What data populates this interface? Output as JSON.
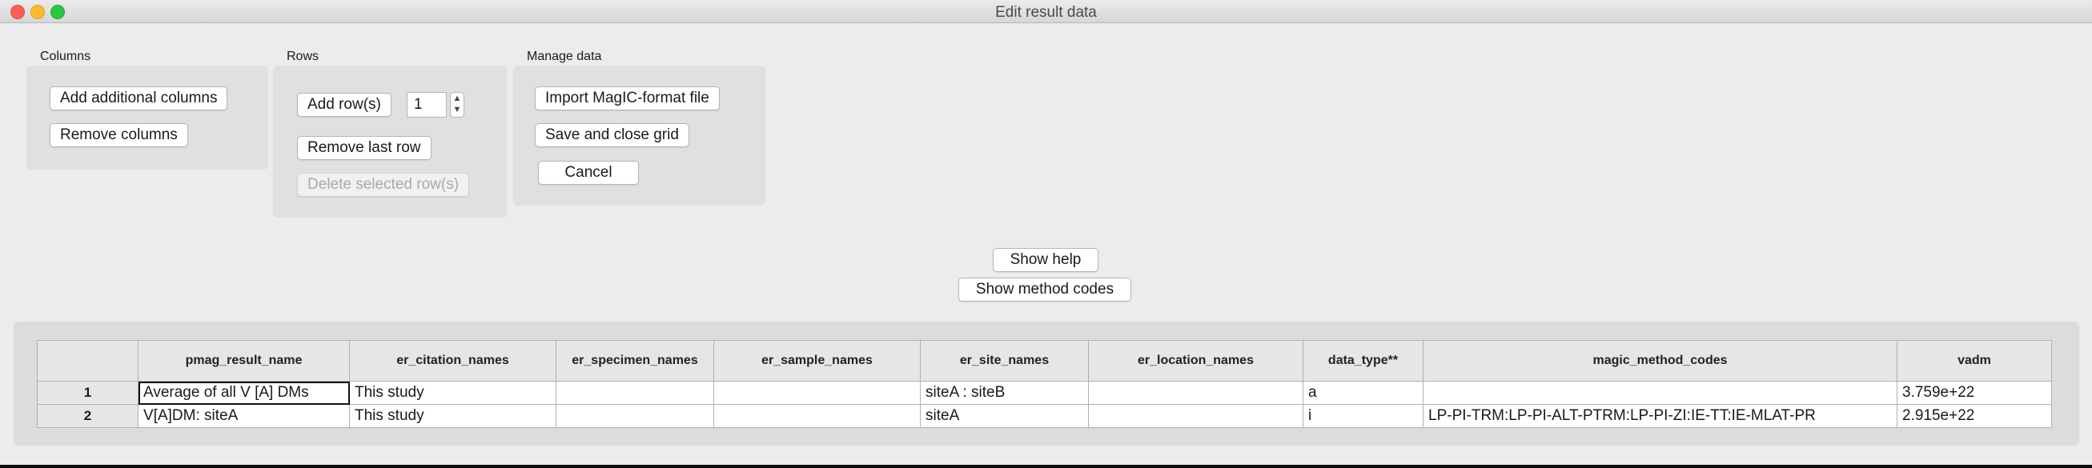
{
  "window": {
    "title": "Edit result data"
  },
  "columns_group": {
    "label": "Columns",
    "add_label": "Add additional columns",
    "remove_label": "Remove columns"
  },
  "rows_group": {
    "label": "Rows",
    "add_label": "Add row(s)",
    "count_value": "1",
    "remove_last_label": "Remove last row",
    "delete_selected_label": "Delete selected row(s)"
  },
  "manage_group": {
    "label": "Manage data",
    "import_label": "Import MagIC-format file",
    "save_label": "Save and close grid",
    "cancel_label": "Cancel"
  },
  "help": {
    "show_help_label": "Show help",
    "show_method_codes_label": "Show method codes"
  },
  "grid": {
    "columns": [
      "pmag_result_name",
      "er_citation_names",
      "er_specimen_names",
      "er_sample_names",
      "er_site_names",
      "er_location_names",
      "data_type**",
      "magic_method_codes",
      "vadm"
    ],
    "rows": [
      {
        "label": "1",
        "cells": [
          "Average of all V [A] DMs",
          "This study",
          "",
          "",
          "siteA : siteB",
          "",
          "a",
          "",
          "3.759e+22"
        ]
      },
      {
        "label": "2",
        "cells": [
          "V[A]DM: siteA",
          "This study",
          "",
          "",
          "siteA",
          "",
          "i",
          "LP-PI-TRM:LP-PI-ALT-PTRM:LP-PI-ZI:IE-TT:IE-MLAT-PR",
          "2.915e+22"
        ]
      }
    ]
  }
}
